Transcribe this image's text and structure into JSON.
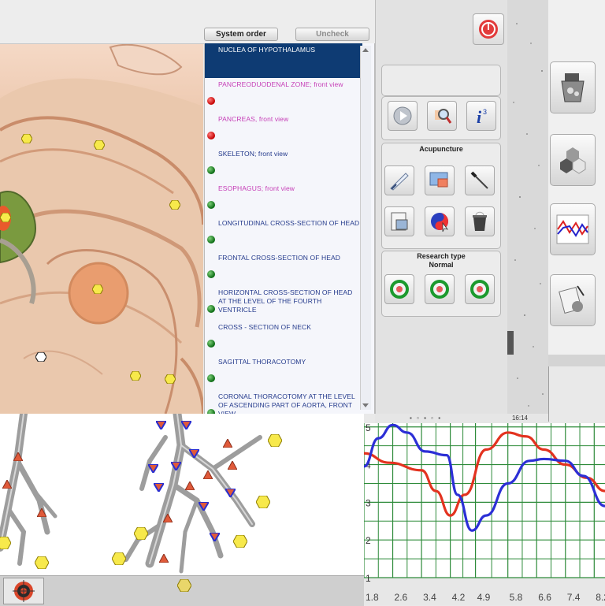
{
  "toolbar": {
    "system_order_label": "System order",
    "uncheck_label": "Uncheck"
  },
  "organ_list": [
    {
      "label": "NUCLEA OF HYPOTHALAMUS",
      "color": "blue",
      "dot": "none",
      "selected": true
    },
    {
      "label": "PANCREODUODENAL ZONE; front view",
      "color": "magenta",
      "dot": "red"
    },
    {
      "label": "PANCREAS,  front  view",
      "color": "magenta",
      "dot": "red"
    },
    {
      "label": "SKELETON; front view",
      "color": "blue",
      "dot": "green"
    },
    {
      "label": "ESOPHAGUS; front view",
      "color": "magenta",
      "dot": "green"
    },
    {
      "label": "LONGITUDINAL CROSS-SECTION OF HEAD",
      "color": "blue",
      "dot": "green"
    },
    {
      "label": "FRONTAL CROSS-SECTION OF HEAD",
      "color": "blue",
      "dot": "green"
    },
    {
      "label": "HORIZONTAL CROSS-SECTION OF HEAD AT THE LEVEL OF THE FOURTH VENTRICLE",
      "color": "blue",
      "dot": "green"
    },
    {
      "label": "CROSS - SECTION  OF   NECK",
      "color": "blue",
      "dot": "green"
    },
    {
      "label": "SAGITTAL THORACOTOMY",
      "color": "blue",
      "dot": "green"
    },
    {
      "label": "CORONAL THORACOTOMY AT THE LEVEL OF ASCENDING PART OF AORTA, FRONT VIEW",
      "color": "blue",
      "dot": "green"
    }
  ],
  "control_panel": {
    "acupuncture_label": "Acupuncture",
    "research_type_label": "Research type",
    "research_mode": "Normal",
    "icons": [
      "play-icon",
      "magnifier-icon",
      "info-icon",
      "quill-icon",
      "monitor-icon",
      "needle-icon",
      "report-icon",
      "yinyang-icon",
      "bin-icon",
      "clock-icon"
    ]
  },
  "status": {
    "time": "16:14"
  },
  "colors": {
    "selected_row": "#0e3b73",
    "item_blue": "#243a8c",
    "item_magenta": "#c63fb7",
    "series_red": "#e3321f",
    "series_blue": "#2c2fd6",
    "grid_green": "#2e8b3a"
  },
  "chart_data": {
    "type": "line",
    "x_ticks": [
      "1.8",
      "2.6",
      "3.4",
      "4.2",
      "4.9",
      "5.8",
      "6.6",
      "7.4",
      "8.2"
    ],
    "y_ticks": [
      "1",
      "2",
      "3",
      "4",
      "5"
    ],
    "ylim": [
      1,
      5.1
    ],
    "xlim": [
      1.8,
      8.5
    ],
    "series": [
      {
        "color": "#e3321f",
        "x": [
          1.8,
          2.5,
          3.4,
          3.8,
          4.2,
          4.6,
          5.2,
          5.8,
          6.3,
          6.8,
          7.4,
          8.0,
          8.5
        ],
        "y": [
          4.3,
          4.05,
          3.85,
          3.3,
          2.65,
          3.2,
          4.4,
          4.85,
          4.75,
          4.4,
          4.0,
          3.65,
          3.3
        ]
      },
      {
        "color": "#2c2fd6",
        "x": [
          1.8,
          2.2,
          2.6,
          3.0,
          3.5,
          4.1,
          4.4,
          4.8,
          5.2,
          5.8,
          6.4,
          6.8,
          7.4,
          7.9,
          8.5
        ],
        "y": [
          3.95,
          4.7,
          5.05,
          4.85,
          4.35,
          4.25,
          3.2,
          2.25,
          2.65,
          3.5,
          4.1,
          4.15,
          4.1,
          3.7,
          2.9
        ]
      }
    ]
  }
}
